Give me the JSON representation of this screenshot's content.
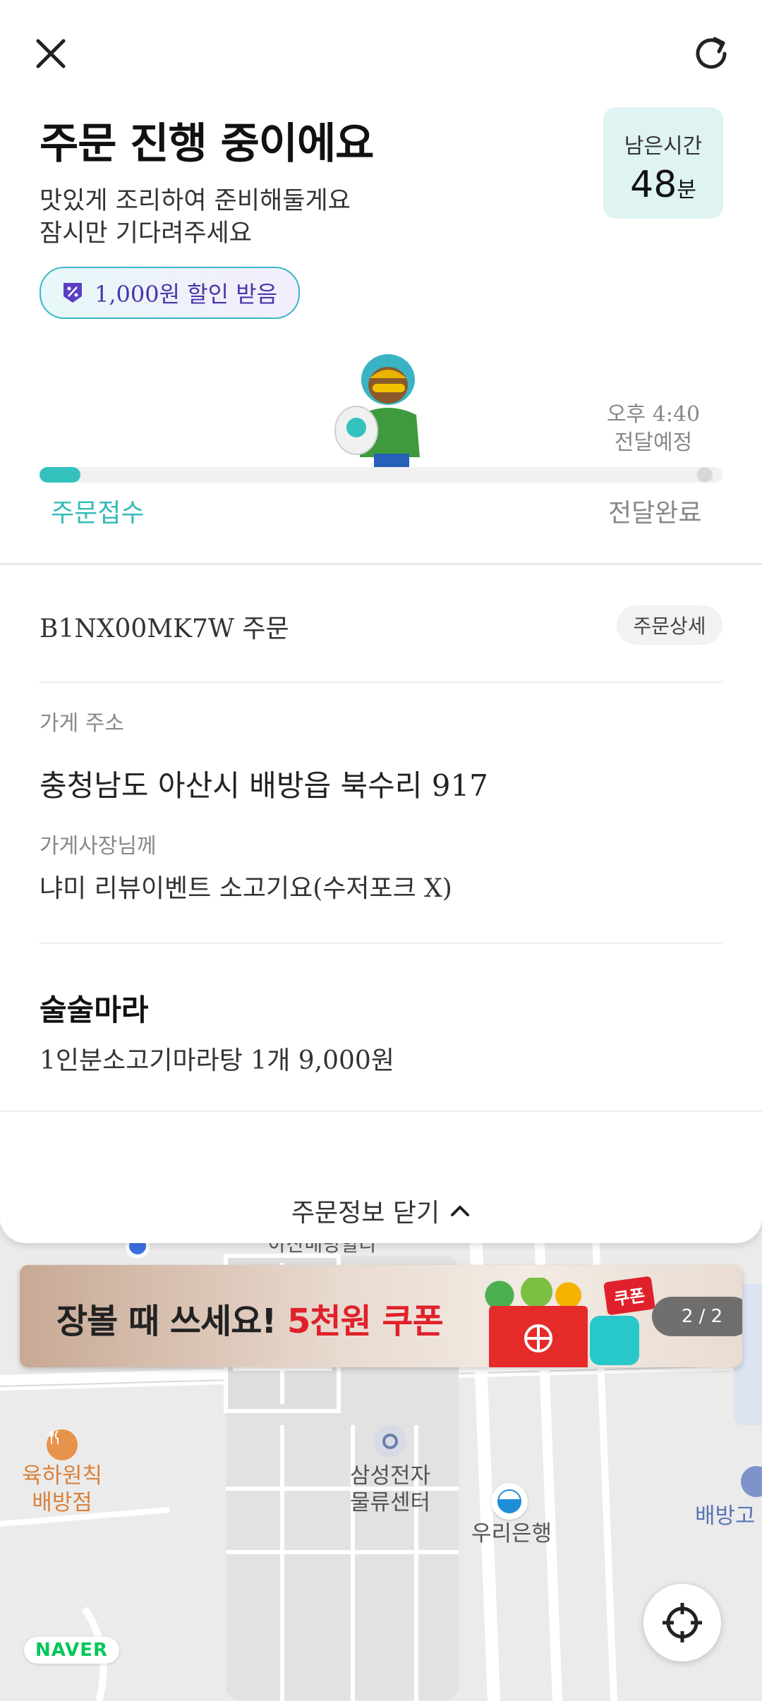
{
  "header": {
    "close_icon": "close-icon",
    "refresh_icon": "refresh-icon"
  },
  "status": {
    "title": "주문 진행 중이에요",
    "subtitle_line1": "맛있게 조리하여 준비해둘게요",
    "subtitle_line2": "잠시만 기다려주세요",
    "remaining_label": "남은시간",
    "remaining_value": "48",
    "remaining_unit": "분",
    "discount_badge": "1,000원 할인 받음",
    "eta_time": "오후 4:40",
    "eta_label": "전달예정",
    "progress_fraction": 0.06,
    "step_start": "주문접수",
    "step_end": "전달완료",
    "accent_color": "#35c2bf"
  },
  "order": {
    "id_text": "B1NX00MK7W 주문",
    "detail_button": "주문상세",
    "address_label": "가게 주소",
    "address": "충청남도 아산시 배방읍 북수리 917",
    "request_label": "가게사장님께",
    "request": "냐미 리뷰이벤트 소고기요(수저포크 X)",
    "store_name": "술술마라",
    "item": "1인분소고기마라탕 1개 9,000원",
    "close_label": "주문정보 닫기"
  },
  "banner": {
    "text_main": "장볼 때 쓰세요! ",
    "text_highlight": "5천원 쿠폰",
    "tag": "쿠폰",
    "page_indicator": "2 / 2"
  },
  "map": {
    "partial_label": "아산배방할라",
    "poi_1": "육하원칙",
    "poi_1b": "배방점",
    "poi_2": "삼성전자",
    "poi_2b": "물류센터",
    "poi_3": "우리은행",
    "poi_4": "배방고",
    "naver_logo": "NAVER"
  }
}
